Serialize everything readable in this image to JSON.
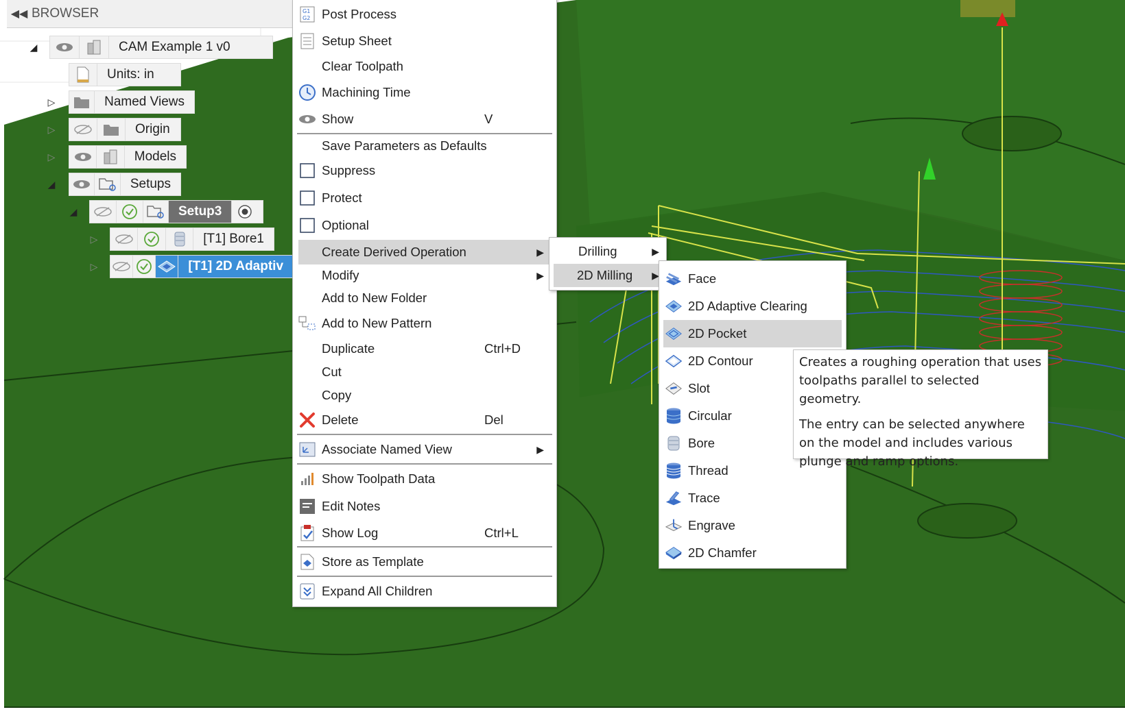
{
  "browser": {
    "title": "BROWSER",
    "tree": {
      "root": "CAM Example 1 v0",
      "units": "Units: in",
      "named_views": "Named Views",
      "origin": "Origin",
      "models": "Models",
      "setups": "Setups",
      "setup3": "Setup3",
      "op1": "[T1] Bore1",
      "op2": "[T1] 2D Adaptiv"
    }
  },
  "context_menu": {
    "items": [
      {
        "label": "Post Process",
        "icon": "post-process-icon"
      },
      {
        "label": "Setup Sheet",
        "icon": "setup-sheet-icon"
      },
      {
        "label": "Clear Toolpath"
      },
      {
        "label": "Machining Time",
        "icon": "clock-icon"
      },
      {
        "label": "Show",
        "icon": "eye-icon",
        "shortcut": "V"
      },
      {
        "label": "Save Parameters as Defaults"
      },
      {
        "label": "Suppress",
        "icon": "checkbox-icon"
      },
      {
        "label": "Protect",
        "icon": "checkbox-icon"
      },
      {
        "label": "Optional",
        "icon": "checkbox-icon"
      },
      {
        "label": "Create Derived Operation",
        "submenu": true
      },
      {
        "label": "Modify",
        "submenu": true
      },
      {
        "label": "Add to New Folder"
      },
      {
        "label": "Add to New Pattern",
        "icon": "pattern-icon"
      },
      {
        "label": "Duplicate",
        "shortcut": "Ctrl+D"
      },
      {
        "label": "Cut"
      },
      {
        "label": "Copy"
      },
      {
        "label": "Delete",
        "icon": "delete-icon",
        "shortcut": "Del"
      },
      {
        "label": "Associate Named View",
        "icon": "named-view-icon",
        "submenu": true
      },
      {
        "label": "Show Toolpath Data",
        "icon": "toolpath-data-icon"
      },
      {
        "label": "Edit Notes",
        "icon": "notes-icon"
      },
      {
        "label": "Show Log",
        "icon": "log-icon",
        "shortcut": "Ctrl+L"
      },
      {
        "label": "Store as Template",
        "icon": "template-icon"
      },
      {
        "label": "Expand All Children",
        "icon": "expand-icon"
      }
    ]
  },
  "derived_submenu": {
    "items": [
      {
        "label": "Drilling"
      },
      {
        "label": "2D Milling"
      }
    ]
  },
  "milling_submenu": {
    "items": [
      {
        "label": "Face",
        "icon": "face-icon"
      },
      {
        "label": "2D Adaptive Clearing",
        "icon": "adaptive-icon"
      },
      {
        "label": "2D Pocket",
        "icon": "pocket-icon"
      },
      {
        "label": "2D Contour",
        "icon": "contour-icon"
      },
      {
        "label": "Slot",
        "icon": "slot-icon"
      },
      {
        "label": "Circular",
        "icon": "circular-icon"
      },
      {
        "label": "Bore",
        "icon": "bore-icon"
      },
      {
        "label": "Thread",
        "icon": "thread-icon"
      },
      {
        "label": "Trace",
        "icon": "trace-icon"
      },
      {
        "label": "Engrave",
        "icon": "engrave-icon"
      },
      {
        "label": "2D Chamfer",
        "icon": "chamfer-icon"
      }
    ]
  },
  "tooltip": {
    "para1": "Creates a roughing operation that uses toolpaths parallel to selected geometry.",
    "para2": "The entry can be selected anywhere on the model and includes various plunge and ramp options."
  },
  "colors": {
    "model_green": "#2f6b1f",
    "highlight_grey": "#d6d6d6",
    "selection_blue": "#3b8fd8",
    "toolpath_yellow": "#d9e34a",
    "delete_red": "#e23b2e"
  }
}
